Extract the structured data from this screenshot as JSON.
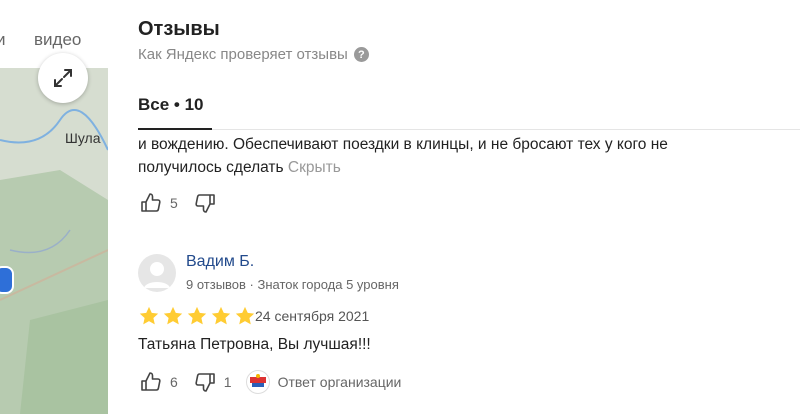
{
  "map": {
    "media_tabs": [
      "и",
      "видео"
    ],
    "place_label": "Шула"
  },
  "reviews": {
    "title": "Отзывы",
    "subtitle": "Как Яндекс проверяет отзывы",
    "tab_all": "Все • 10",
    "items": [
      {
        "text": "и вождению. Обеспечивают поездки в клинцы, и не бросают тех у кого не получилось сделать",
        "hide_label": "Скрыть",
        "likes": "5"
      },
      {
        "author": "Вадим Б.",
        "meta": "9 отзывов · Знаток города 5 уровня",
        "rating": 5,
        "date": "24 сентября 2021",
        "text": "Татьяна Петровна, Вы лучшая!!!",
        "likes": "6",
        "dislikes": "1",
        "org_reply_label": "Ответ организации"
      }
    ]
  },
  "colors": {
    "star": "#fc3",
    "author_link": "#224a8c",
    "muted": "#888"
  },
  "icons": [
    "expand-icon",
    "question-icon",
    "thumb-up-icon",
    "thumb-down-icon",
    "star-icon",
    "avatar-icon",
    "org-logo-icon"
  ]
}
